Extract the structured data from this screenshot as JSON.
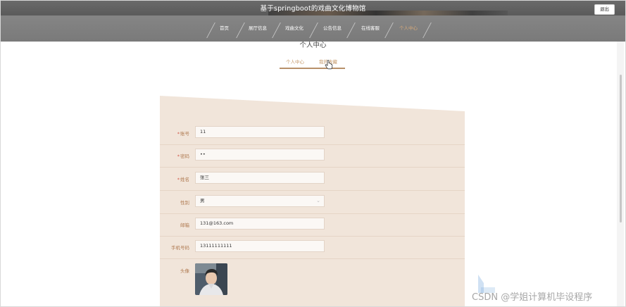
{
  "header": {
    "site_title": "基于springboot的戏曲文化博物馆",
    "logout_label": "退出"
  },
  "nav": {
    "items": [
      {
        "label": "首页",
        "active": false
      },
      {
        "label": "展厅信息",
        "active": false
      },
      {
        "label": "戏曲文化",
        "active": false
      },
      {
        "label": "公告信息",
        "active": false
      },
      {
        "label": "在线客服",
        "active": false
      },
      {
        "label": "个人中心",
        "active": true
      }
    ]
  },
  "page": {
    "title": "个人中心",
    "tabs": [
      {
        "label": "个人中心",
        "active": true
      },
      {
        "label": "我的收藏",
        "active": false
      }
    ]
  },
  "form": {
    "fields": [
      {
        "label": "账号",
        "required": true,
        "value": "11",
        "type": "text"
      },
      {
        "label": "密码",
        "required": true,
        "value": "••",
        "type": "password"
      },
      {
        "label": "姓名",
        "required": true,
        "value": "张三",
        "type": "text"
      },
      {
        "label": "性别",
        "required": false,
        "value": "男",
        "type": "select"
      },
      {
        "label": "邮箱",
        "required": false,
        "value": "131@163.com",
        "type": "text"
      },
      {
        "label": "手机号码",
        "required": false,
        "value": "13111111111",
        "type": "text"
      },
      {
        "label": "头像",
        "required": false,
        "value": "",
        "type": "image"
      }
    ]
  },
  "watermark": {
    "text": "CSDN @学姐计算机毕设程序"
  },
  "colors": {
    "accent": "#c59a6c",
    "nav_active": "#d7a979",
    "card_bg": "#f1e5da",
    "required": "#d15a4a"
  }
}
